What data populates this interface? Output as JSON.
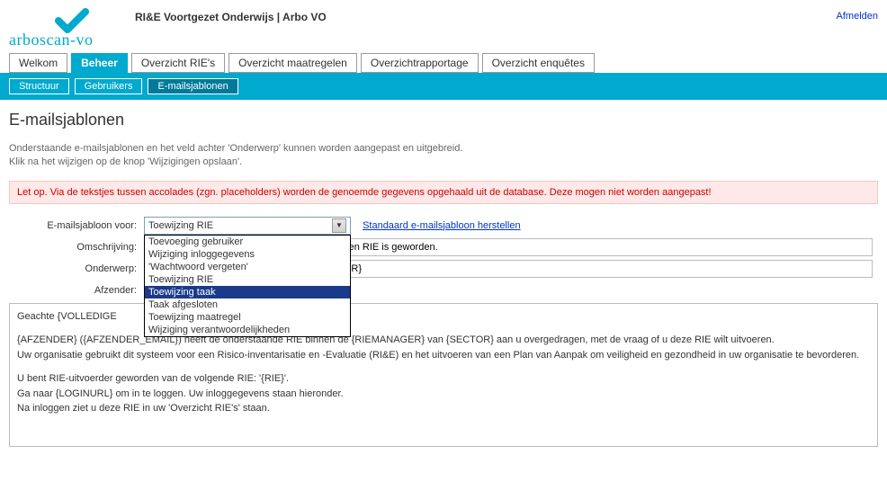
{
  "header": {
    "title": "RI&E Voortgezet Onderwijs | Arbo VO",
    "logout": "Afmelden",
    "logo_text": "arboscan-vo"
  },
  "main_tabs": [
    {
      "label": "Welkom",
      "active": false
    },
    {
      "label": "Beheer",
      "active": true
    },
    {
      "label": "Overzicht RIE's",
      "active": false
    },
    {
      "label": "Overzicht maatregelen",
      "active": false
    },
    {
      "label": "Overzichtrapportage",
      "active": false
    },
    {
      "label": "Overzicht enquêtes",
      "active": false
    }
  ],
  "sub_tabs": [
    {
      "label": "Structuur",
      "active": false
    },
    {
      "label": "Gebruikers",
      "active": false
    },
    {
      "label": "E-mailsjablonen",
      "active": true
    }
  ],
  "page": {
    "heading": "E-mailsjablonen",
    "intro_line1": "Onderstaande e-mailsjablonen en het veld achter 'Onderwerp' kunnen worden aangepast en uitgebreid.",
    "intro_line2": "Klik na het wijzigen op de knop 'Wijzigingen opslaan'.",
    "warning": "Let op. Via de tekstjes tussen accolades (zgn. placeholders) worden de genoemde gegevens opgehaald uit de database. Deze mogen niet worden aangepast!"
  },
  "form": {
    "label_template_for": "E-mailsjabloon voor:",
    "label_description": "Omschrijving:",
    "label_subject": "Onderwerp:",
    "label_sender": "Afzender:",
    "select_value": "Toewijzing RIE",
    "reset_link": "Standaard e-mailsjabloon herstellen",
    "description_value": "en gebruiker nadat deze RIE-uitvoerder van een RIE is geworden.",
    "subject_value": "n een RIE in de {RIEMANAGER} van {SECTOR}",
    "sender_value": ""
  },
  "dropdown_options": [
    {
      "label": "Toevoeging gebruiker",
      "highlight": false
    },
    {
      "label": "Wijziging inloggegevens",
      "highlight": false
    },
    {
      "label": "'Wachtwoord vergeten'",
      "highlight": false
    },
    {
      "label": "Toewijzing RIE",
      "highlight": false
    },
    {
      "label": "Toewijzing taak",
      "highlight": true
    },
    {
      "label": "Taak afgesloten",
      "highlight": false
    },
    {
      "label": "Toewijzing maatregel",
      "highlight": false
    },
    {
      "label": "Wijziging verantwoordelijkheden",
      "highlight": false
    }
  ],
  "body": {
    "p1": "Geachte {VOLLEDIGE",
    "p2": "{AFZENDER} ({AFZENDER_EMAIL}) heeft de onderstaande RIE binnen de {RIEMANAGER} van {SECTOR} aan u overgedragen, met de vraag of u deze RIE wilt uitvoeren.",
    "p3": "Uw organisatie gebruikt dit systeem voor een Risico-inventarisatie en -Evaluatie (RI&E) en het uitvoeren van een Plan van Aanpak om veiligheid en gezondheid in uw organisatie te bevorderen.",
    "p4": "U bent RIE-uitvoerder geworden van de volgende RIE:  '{RIE}'.",
    "p5": "Ga naar {LOGINURL} om in te loggen. Uw inloggegevens staan hieronder.",
    "p6": "Na inloggen ziet u deze RIE in uw 'Overzicht RIE's' staan."
  }
}
